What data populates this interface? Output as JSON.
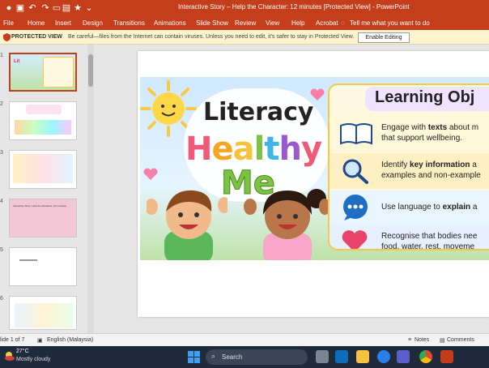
{
  "window": {
    "title": "Interactive Story – Help the Character: 12 minutes [Protected View] - PowerPoint"
  },
  "ribbon": {
    "tabs": [
      "File",
      "Home",
      "Insert",
      "Design",
      "Transitions",
      "Animations",
      "Slide Show",
      "Review",
      "View",
      "Help",
      "Acrobat"
    ],
    "tell_me": "Tell me what you want to do"
  },
  "protected_view": {
    "label": "PROTECTED VIEW",
    "message": "Be careful—files from the Internet can contain viruses. Unless you need to edit, it's safer to stay in Protected View.",
    "button": "Enable Editing"
  },
  "thumbnails": {
    "numbers": [
      "1",
      "2",
      "3",
      "4",
      "5",
      "6"
    ],
    "slide4_text": "Interactive Story: Help the Character (12 minutes)"
  },
  "slide": {
    "title_literacy": "Literacy",
    "title_healthy": [
      "H",
      "e",
      "a",
      "l",
      "t",
      "h",
      "y"
    ],
    "title_me": "Me",
    "learning_title": "Learning Obj",
    "objectives": [
      {
        "line1_pre": "Engage with ",
        "line1_bold": "texts",
        "line1_post": " about m",
        "line2": "that support wellbeing."
      },
      {
        "line1_pre": "Identify ",
        "line1_bold": "key information",
        "line1_post": " a",
        "line2": "examples and non-example"
      },
      {
        "line1_pre": "Use language to ",
        "line1_bold": "explain",
        "line1_post": " a",
        "line2": ""
      },
      {
        "line1_pre": "Recognise that bodies nee",
        "line1_bold": "",
        "line1_post": "",
        "line2": "food, water, rest, moveme"
      }
    ]
  },
  "status": {
    "slide_counter": "lide 1 of 7",
    "language": "English (Malaysia)",
    "notes": "Notes",
    "comments": "Comments"
  },
  "taskbar": {
    "temperature": "27°C",
    "weather": "Mostly cloudy",
    "search": "Search"
  },
  "colors": {
    "accent": "#c43e1c",
    "healthy": [
      "#f05a78",
      "#f5a623",
      "#f7d23e",
      "#7cc243",
      "#3fb6e8",
      "#9b59d0",
      "#f05a78"
    ],
    "me": "#7cc243"
  }
}
